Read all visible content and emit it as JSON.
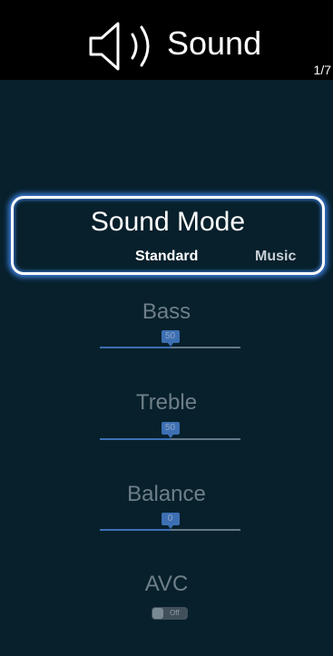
{
  "header": {
    "title": "Sound",
    "icon": "speaker-icon",
    "page_indicator": "1/7"
  },
  "sound_mode": {
    "label": "Sound Mode",
    "options": [
      "Standard",
      "Music"
    ],
    "selected": "Standard"
  },
  "settings": {
    "bass": {
      "label": "Bass",
      "value": "50",
      "fraction": 0.5
    },
    "treble": {
      "label": "Treble",
      "value": "50",
      "fraction": 0.5
    },
    "balance": {
      "label": "Balance",
      "value": "0",
      "fraction": 0.5
    }
  },
  "avc": {
    "label": "AVC",
    "state": "Off"
  },
  "colors": {
    "background": "#07202c",
    "header": "#000000",
    "focus_glow": "#3a7bd5",
    "slider_fill": "#3d6fb3"
  }
}
